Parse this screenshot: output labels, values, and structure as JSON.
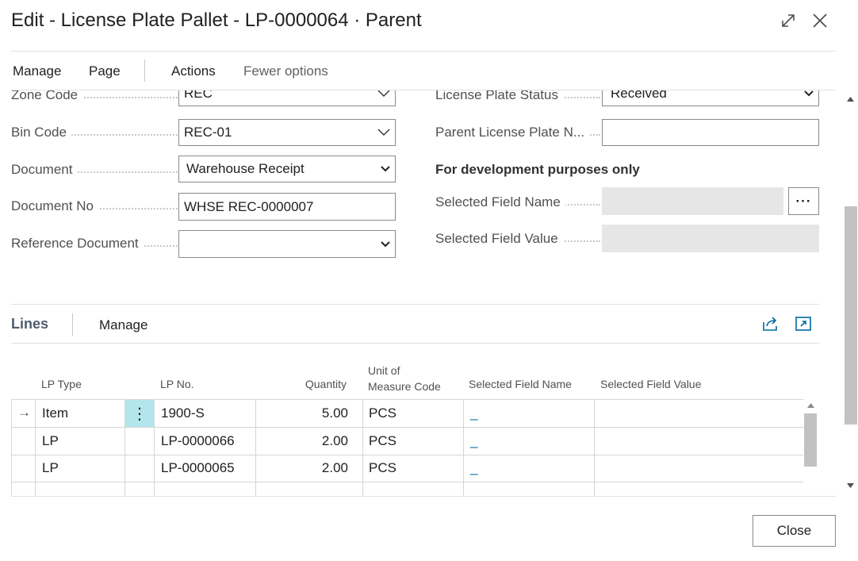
{
  "dialog": {
    "title": "Edit - License Plate Pallet - LP-0000064 · Parent"
  },
  "window_icons": {
    "expand": "expand-icon",
    "close": "close-icon"
  },
  "menu": {
    "manage": "Manage",
    "page": "Page",
    "actions": "Actions",
    "fewer_options": "Fewer options"
  },
  "general": {
    "zone_code": {
      "label": "Zone Code",
      "value": "REC"
    },
    "bin_code": {
      "label": "Bin Code",
      "value": "REC-01"
    },
    "document": {
      "label": "Document",
      "value": "Warehouse Receipt"
    },
    "document_no": {
      "label": "Document No",
      "value": "WHSE REC-0000007"
    },
    "reference_document": {
      "label": "Reference Document",
      "value": ""
    },
    "license_plate_status": {
      "label": "License Plate Status",
      "value": "Received"
    },
    "parent_license_plate_no": {
      "label": "Parent License Plate N...",
      "value": ""
    },
    "dev_heading": "For development purposes only",
    "selected_field_name": {
      "label": "Selected Field Name",
      "value": ""
    },
    "selected_field_value": {
      "label": "Selected Field Value",
      "value": ""
    },
    "lookup_button": "···"
  },
  "lines": {
    "title": "Lines",
    "manage": "Manage",
    "columns": {
      "lp_type": "LP Type",
      "lp_no": "LP No.",
      "quantity": "Quantity",
      "uom_line1": "Unit of",
      "uom_line2": "Measure Code",
      "selected_field_name": "Selected Field Name",
      "selected_field_value": "Selected Field Value"
    },
    "rows": [
      {
        "lp_type": "Item",
        "lp_no": "1900-S",
        "quantity": "5.00",
        "uom": "PCS",
        "selected_field_name": "_",
        "selected_field_value": ""
      },
      {
        "lp_type": "LP",
        "lp_no": "LP-0000066",
        "quantity": "2.00",
        "uom": "PCS",
        "selected_field_name": "_",
        "selected_field_value": ""
      },
      {
        "lp_type": "LP",
        "lp_no": "LP-0000065",
        "quantity": "2.00",
        "uom": "PCS",
        "selected_field_name": "_",
        "selected_field_value": ""
      }
    ],
    "row_indicator": "→",
    "row_menu": "⋮"
  },
  "footer": {
    "close": "Close"
  },
  "colors": {
    "accent_link": "#00689d",
    "selected_cell": "#b3e5ec"
  }
}
